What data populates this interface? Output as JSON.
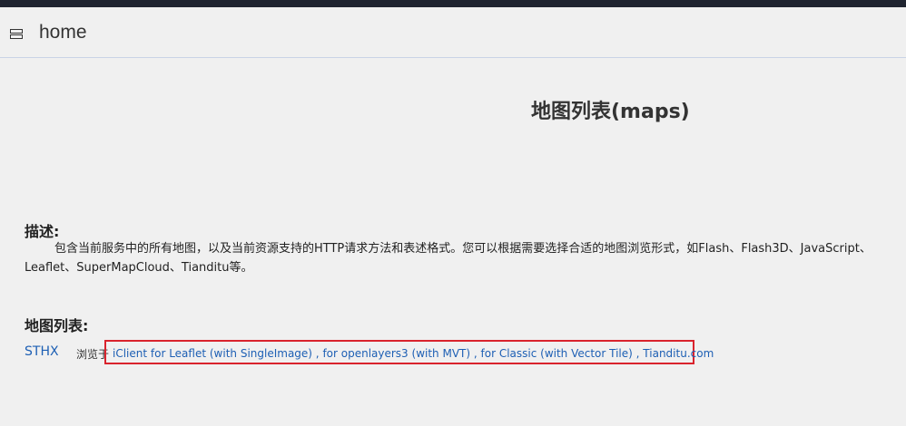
{
  "header": {
    "home_label": "home"
  },
  "page": {
    "title": "地图列表(maps)"
  },
  "description": {
    "heading": "描述:",
    "line1": "包含当前服务中的所有地图，以及当前资源支持的HTTP请求方法和表述格式。您可以根据需要选择合适的地图浏览形式，如Flash、Flash3D、JavaScript、",
    "line2": "Leaflet、SuperMapCloud、Tianditu等。"
  },
  "map_list": {
    "heading": "地图列表:",
    "items": [
      {
        "name": "STHX",
        "browse_label": "浏览于",
        "links": [
          "iClient for Leaflet (with SingleImage)",
          "for openlayers3 (with MVT)",
          "for Classic (with Vector Tile)",
          "Tianditu.com"
        ],
        "separator": " , "
      }
    ]
  },
  "colors": {
    "link": "#1d5fb4",
    "highlight_border": "#d9232d",
    "top_bar": "#1f2430",
    "background": "#f0f0f0"
  }
}
